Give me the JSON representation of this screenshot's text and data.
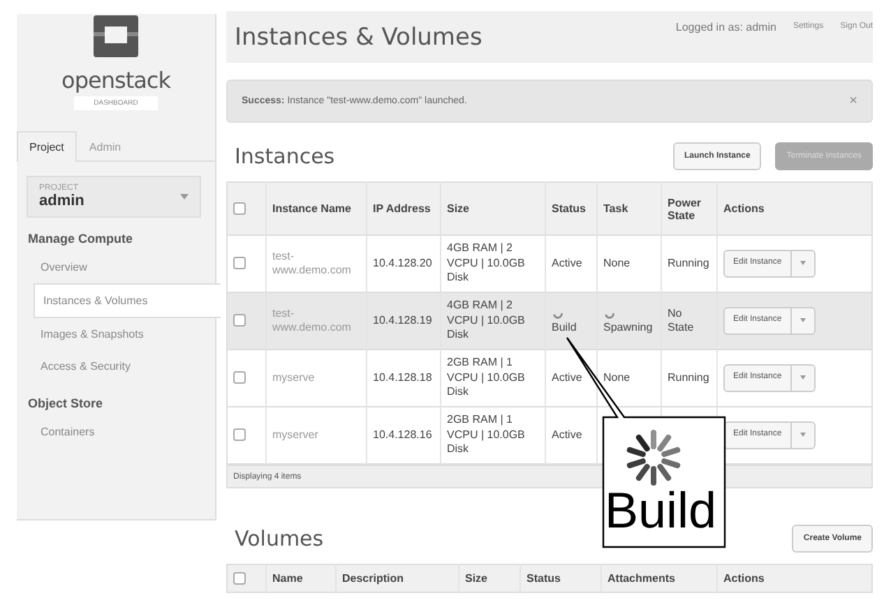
{
  "sidebar": {
    "brand": "openstack",
    "subtitle": "DASHBOARD",
    "tabs": [
      {
        "label": "Project",
        "selected": true
      },
      {
        "label": "Admin",
        "selected": false
      }
    ],
    "project": {
      "label": "PROJECT",
      "value": "admin"
    },
    "sections": [
      {
        "title": "Manage Compute",
        "items": [
          {
            "label": "Overview",
            "selected": false
          },
          {
            "label": "Instances & Volumes",
            "selected": true
          },
          {
            "label": "Images & Snapshots",
            "selected": false
          },
          {
            "label": "Access & Security",
            "selected": false
          }
        ]
      },
      {
        "title": "Object Store",
        "items": [
          {
            "label": "Containers",
            "selected": false
          }
        ]
      }
    ]
  },
  "header": {
    "title": "Instances & Volumes",
    "user": "Logged in as: admin",
    "links": [
      "Settings",
      "Sign Out"
    ]
  },
  "alert": {
    "text": "**Success:** Instance \"test-www.demo.com\" launched.",
    "close": "×"
  },
  "instances": {
    "title": "Instances",
    "buttons": [
      {
        "label": "Launch Instance",
        "disabled": false
      },
      {
        "label": "Terminate Instances",
        "disabled": true
      }
    ],
    "all_checked": false,
    "columns": [
      "Instance Name",
      "IP Address",
      "Size",
      "Status",
      "Task",
      "Power State",
      "Actions"
    ],
    "rows": [
      {
        "checked": false,
        "highlighted": false,
        "name": "test-www.demo.com",
        "ip": "10.4.128.20",
        "size": "4GB RAM | 2 VCPU | 10.0GB Disk",
        "status": {
          "text": "Active",
          "busy": false
        },
        "task": {
          "text": "None",
          "busy": false
        },
        "power": "Running",
        "action": "Edit Instance"
      },
      {
        "checked": false,
        "highlighted": true,
        "name": "test-www.demo.com",
        "ip": "10.4.128.19",
        "size": "4GB RAM | 2 VCPU | 10.0GB Disk",
        "status": {
          "text": "Build",
          "busy": true
        },
        "task": {
          "text": "Spawning",
          "busy": true
        },
        "power": "No State",
        "action": "Edit Instance"
      },
      {
        "checked": false,
        "highlighted": false,
        "name": "myserve",
        "ip": "10.4.128.18",
        "size": "2GB RAM | 1 VCPU | 10.0GB Disk",
        "status": {
          "text": "Active",
          "busy": false
        },
        "task": {
          "text": "None",
          "busy": false
        },
        "power": "Running",
        "action": "Edit Instance"
      },
      {
        "checked": false,
        "highlighted": false,
        "name": "myserver",
        "ip": "10.4.128.16",
        "size": "2GB RAM | 1 VCPU | 10.0GB Disk",
        "status": {
          "text": "Active",
          "busy": false
        },
        "action": "Edit Instance"
      }
    ],
    "footer": "Displaying 4 items"
  },
  "callout": {
    "text": "Build"
  },
  "volumes": {
    "title": "Volumes",
    "buttons": [
      {
        "label": "Create Volume",
        "disabled": false
      }
    ],
    "all_checked": false,
    "columns": [
      "Name",
      "Description",
      "Size",
      "Status",
      "Attachments",
      "Actions"
    ]
  }
}
